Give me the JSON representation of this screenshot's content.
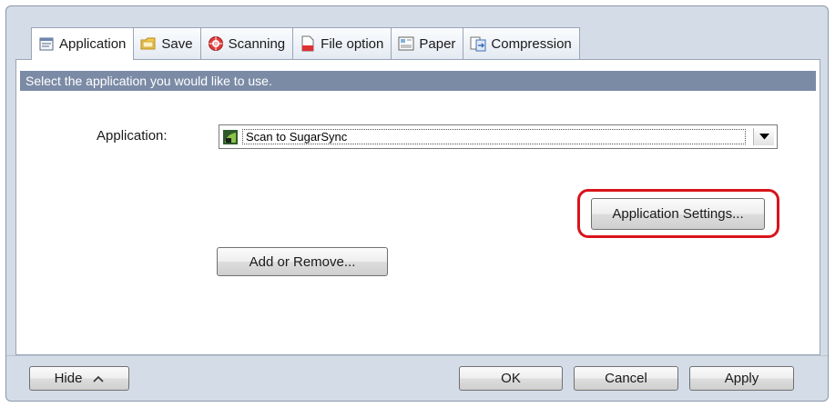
{
  "tabs": [
    {
      "label": "Application",
      "icon": "application-icon",
      "active": true
    },
    {
      "label": "Save",
      "icon": "folder-icon",
      "active": false
    },
    {
      "label": "Scanning",
      "icon": "scanning-icon",
      "active": false
    },
    {
      "label": "File option",
      "icon": "file-option-icon",
      "active": false
    },
    {
      "label": "Paper",
      "icon": "paper-icon",
      "active": false
    },
    {
      "label": "Compression",
      "icon": "compression-icon",
      "active": false
    }
  ],
  "panel": {
    "header": "Select the application you would like to use.",
    "application_label": "Application:",
    "application_selected": "Scan to SugarSync",
    "application_settings_button": "Application Settings...",
    "add_remove_button": "Add or Remove..."
  },
  "footer": {
    "hide_button": "Hide",
    "ok_button": "OK",
    "cancel_button": "Cancel",
    "apply_button": "Apply"
  },
  "colors": {
    "header_bar": "#7b8ba6",
    "highlight": "#d8141c",
    "dialog_background": "#d4dce8"
  }
}
